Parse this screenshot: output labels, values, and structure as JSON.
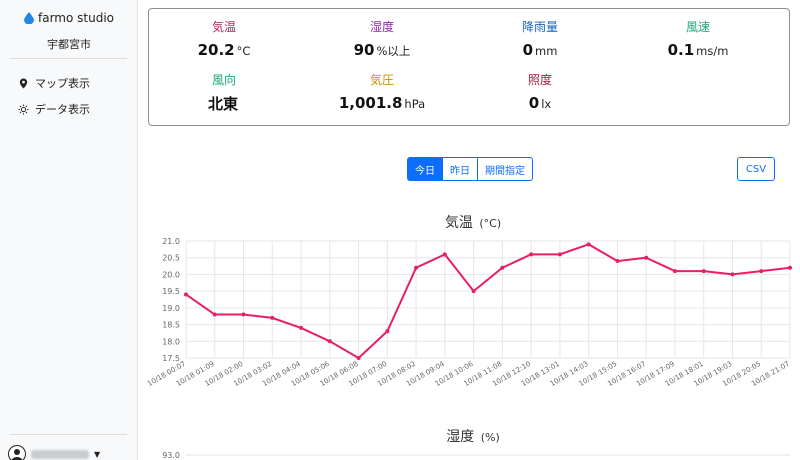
{
  "sidebar": {
    "brand": "farmo studio",
    "city": "宇都宮市",
    "nav": [
      {
        "label": "マップ表示",
        "icon": "map-pin-icon"
      },
      {
        "label": "データ表示",
        "icon": "sun-icon"
      }
    ]
  },
  "metrics": [
    {
      "label": "気温",
      "value": "20.2",
      "unit": "°C",
      "color": "#c2185b"
    },
    {
      "label": "湿度",
      "value": "90",
      "unit": "%以上",
      "color": "#8e24aa"
    },
    {
      "label": "降雨量",
      "value": "0",
      "unit": "mm",
      "color": "#1565c0"
    },
    {
      "label": "風速",
      "value": "0.1",
      "unit": "ms/m",
      "color": "#1fa67a"
    },
    {
      "label": "風向",
      "value": "北東",
      "unit": "",
      "color": "#1fa67a"
    },
    {
      "label": "気圧",
      "value": "1,001.8",
      "unit": "hPa",
      "color": "#d18a00"
    },
    {
      "label": "照度",
      "value": "0",
      "unit": "lx",
      "color": "#b0143b"
    }
  ],
  "controls": {
    "today": "今日",
    "yesterday": "昨日",
    "period": "期間指定",
    "csv": "CSV"
  },
  "chart_data": [
    {
      "type": "line",
      "title": "気温",
      "unit": "(°C)",
      "color": "#e91e63",
      "x": [
        "10/18 00:07",
        "10/18 01:09",
        "10/18 02:00",
        "10/18 03:02",
        "10/18 04:04",
        "10/18 05:06",
        "10/18 06:08",
        "10/18 07:00",
        "10/18 08:02",
        "10/18 09:04",
        "10/18 10:06",
        "10/18 11:08",
        "10/18 12:10",
        "10/18 13:01",
        "10/18 14:03",
        "10/18 15:05",
        "10/18 16:07",
        "10/18 17:09",
        "10/18 18:01",
        "10/18 19:03",
        "10/18 20:05",
        "10/18 21:07"
      ],
      "values": [
        19.4,
        18.8,
        18.8,
        18.7,
        18.4,
        18.0,
        17.5,
        18.3,
        20.2,
        20.6,
        19.5,
        20.2,
        20.6,
        20.6,
        20.9,
        20.4,
        20.5,
        20.1,
        20.1,
        20.0,
        20.1,
        20.2
      ],
      "yticks": [
        "21.0",
        "20.5",
        "20.0",
        "19.5",
        "19.0",
        "18.5",
        "18.0",
        "17.5"
      ],
      "ylim": [
        17.5,
        21.0
      ],
      "grid": true
    },
    {
      "type": "line",
      "title": "湿度",
      "unit": "(%)",
      "yticks": [
        "93.0"
      ]
    }
  ]
}
